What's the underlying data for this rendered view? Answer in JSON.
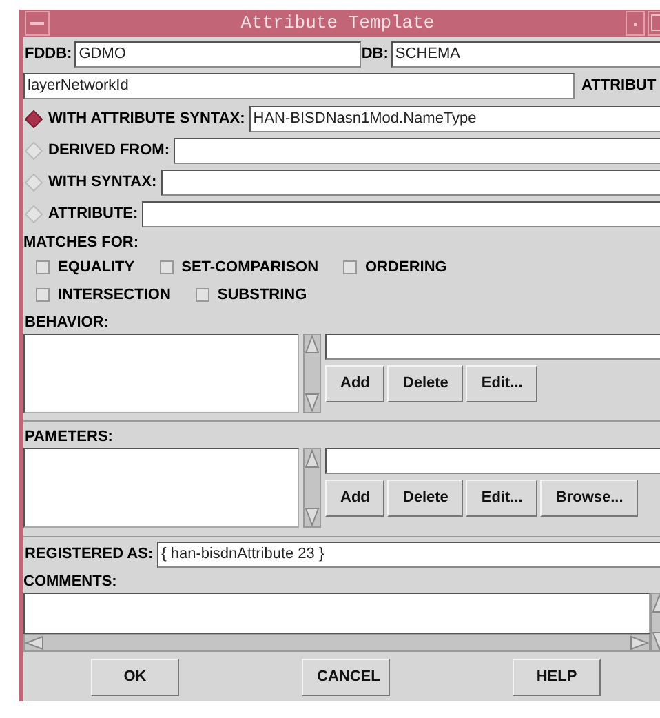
{
  "window": {
    "title": "Attribute Template"
  },
  "header": {
    "fddb_label": "FDDB:",
    "fddb_value": "GDMO",
    "db_label": "DB:",
    "db_value": "SCHEMA",
    "name_value": "layerNetworkId",
    "name_label": "ATTRIBUT"
  },
  "syntax_options": [
    {
      "label": "WITH ATTRIBUTE SYNTAX:",
      "value": "HAN-BISDNasn1Mod.NameType",
      "selected": true
    },
    {
      "label": "DERIVED FROM:",
      "selected": false
    },
    {
      "label": "WITH SYNTAX:",
      "selected": false
    },
    {
      "label": "ATTRIBUTE:",
      "selected": false
    }
  ],
  "matches": {
    "label": "MATCHES FOR:",
    "rows": [
      [
        {
          "label": "EQUALITY",
          "checked": false
        },
        {
          "label": "SET-COMPARISON",
          "checked": false
        },
        {
          "label": "ORDERING",
          "checked": false
        }
      ],
      [
        {
          "label": "INTERSECTION",
          "checked": false
        },
        {
          "label": "SUBSTRING",
          "checked": false
        }
      ]
    ]
  },
  "behavior": {
    "label": "BEHAVIOR:",
    "buttons": [
      "Add",
      "Delete",
      "Edit..."
    ]
  },
  "parameters": {
    "label": "PAMETERS:",
    "buttons": [
      "Add",
      "Delete",
      "Edit...",
      "Browse..."
    ]
  },
  "registered": {
    "label": "REGISTERED AS:",
    "value": "{ han-bisdnAttribute 23 }"
  },
  "comments": {
    "label": "COMMENTS:"
  },
  "buttons": [
    "OK",
    "CANCEL",
    "HELP"
  ]
}
